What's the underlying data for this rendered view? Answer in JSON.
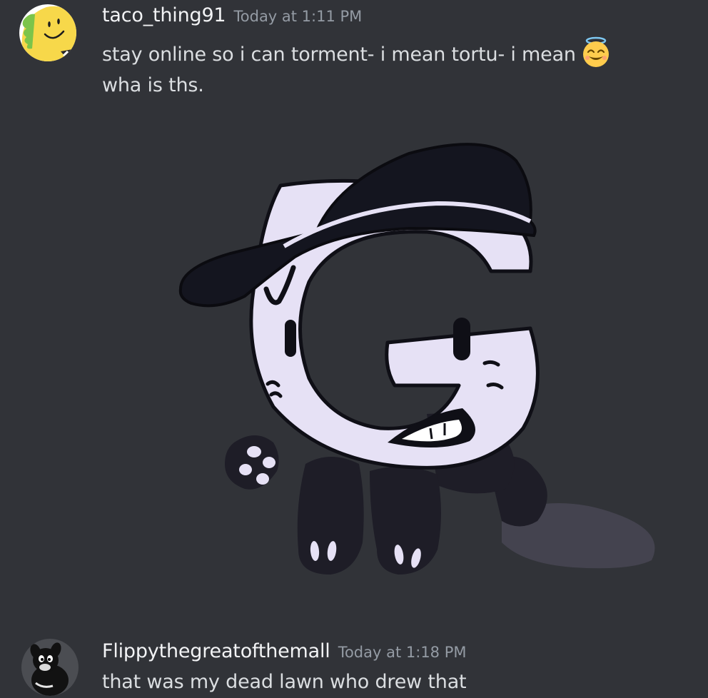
{
  "messages": [
    {
      "username": "taco_thing91",
      "timestamp": "Today at 1:11 PM",
      "lines": [
        "stay online so i can torment- i mean tortu- i mean",
        "wha is ths."
      ],
      "emoji": "smiling-face-with-halo",
      "avatar_icon": "taco-icon",
      "attachment": "drawing-letter-g-character-with-cap"
    },
    {
      "username": "Flippythegreatofthemall",
      "timestamp": "Today at 1:18 PM",
      "lines": [
        "that was my dead lawn who drew that"
      ],
      "avatar_icon": "dog-icon"
    }
  ],
  "colors": {
    "background": "#313338",
    "username": "#f2f3f5",
    "timestamp": "#949ba4",
    "text": "#dbdee1",
    "character_body": "#e6e1f5",
    "cap": "#14151f"
  }
}
